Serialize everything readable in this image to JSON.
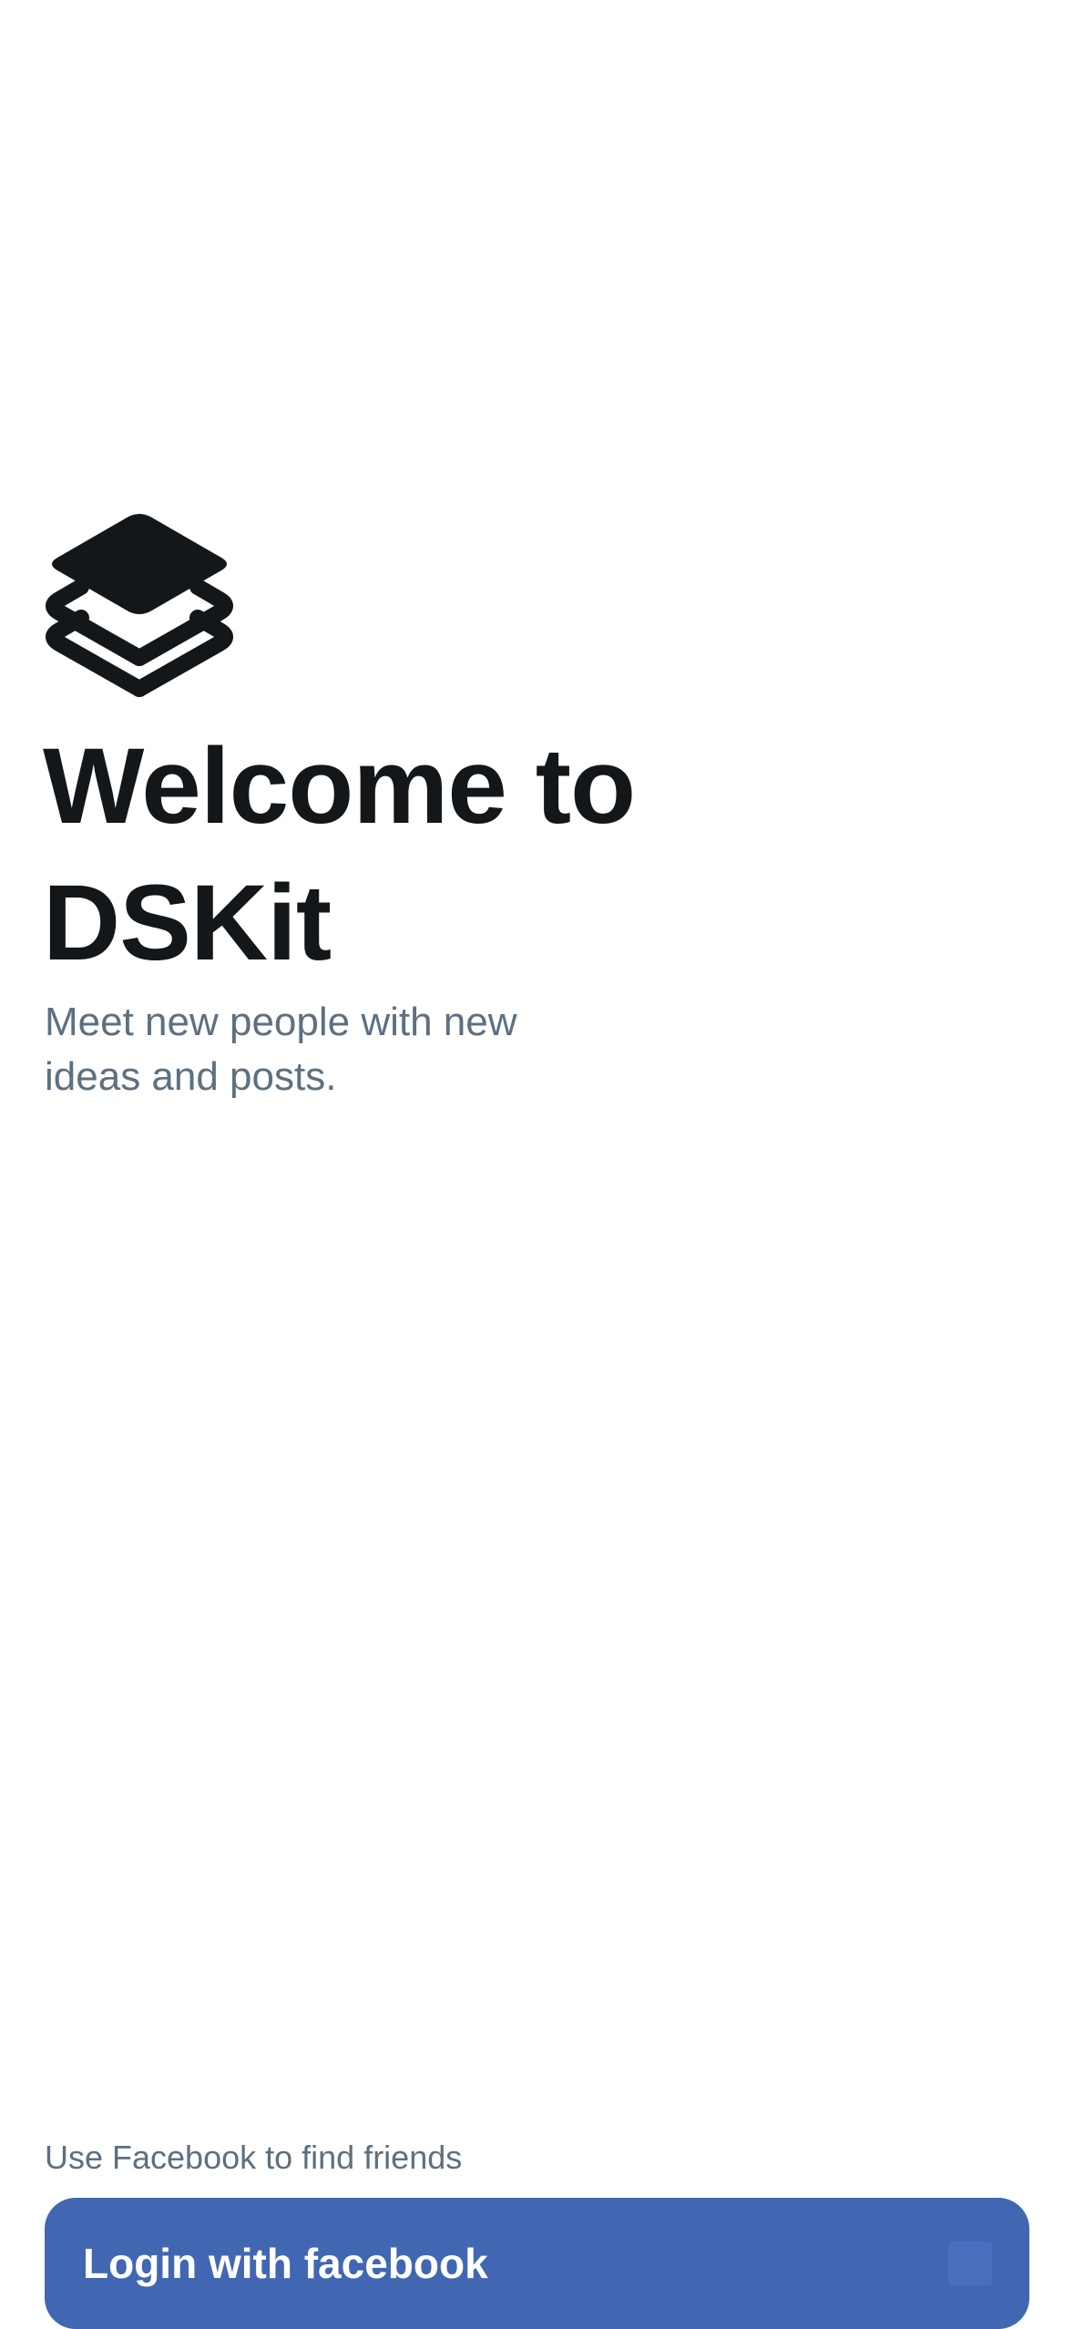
{
  "logo": {
    "icon": "layers-icon",
    "color": "#14171a"
  },
  "welcome": {
    "title_line1": "Welcome to",
    "title_line2": "DSKit",
    "subtitle_line1": "Meet new people with new",
    "subtitle_line2": "ideas and posts."
  },
  "footer": {
    "hint": "Use Facebook to find friends",
    "facebook_button_label": "Login with facebook",
    "facebook_icon": "facebook-icon",
    "button_color": "#4267b2"
  }
}
